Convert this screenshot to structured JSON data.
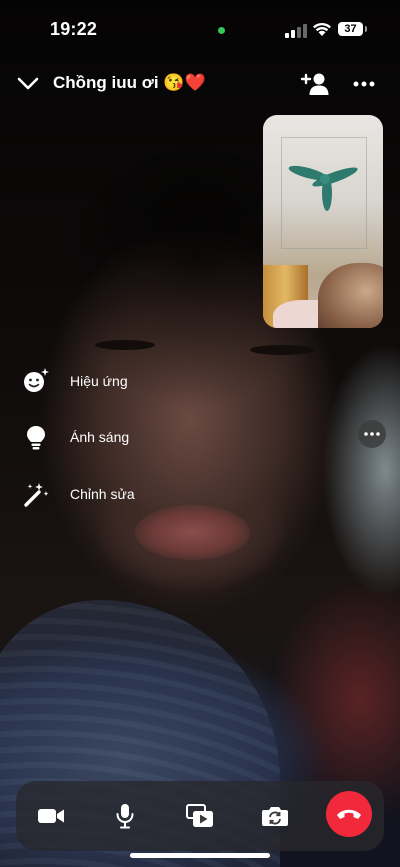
{
  "status_bar": {
    "time": "19:22",
    "battery": "37",
    "camera_indicator_color": "#34c759"
  },
  "call": {
    "caller_name": "Chồng iuu ơi 😘❤️",
    "icons": {
      "back": "chevron-down-icon",
      "add_person": "add-person-icon",
      "more": "more-icon"
    }
  },
  "effects_menu": {
    "items": [
      {
        "label": "Hiệu ứng",
        "icon": "sparkle-face-icon"
      },
      {
        "label": "Ánh sáng",
        "icon": "lightbulb-icon"
      },
      {
        "label": "Chỉnh sửa",
        "icon": "magic-wand-icon"
      }
    ],
    "more_icon": "more-icon"
  },
  "controls": {
    "buttons": [
      {
        "name": "video-camera-button",
        "icon": "video-camera-icon"
      },
      {
        "name": "microphone-button",
        "icon": "microphone-icon"
      },
      {
        "name": "share-screen-button",
        "icon": "share-media-icon"
      },
      {
        "name": "flip-camera-button",
        "icon": "flip-camera-icon"
      },
      {
        "name": "end-call-button",
        "icon": "hang-up-icon"
      }
    ],
    "end_call_color": "#f2293a"
  }
}
